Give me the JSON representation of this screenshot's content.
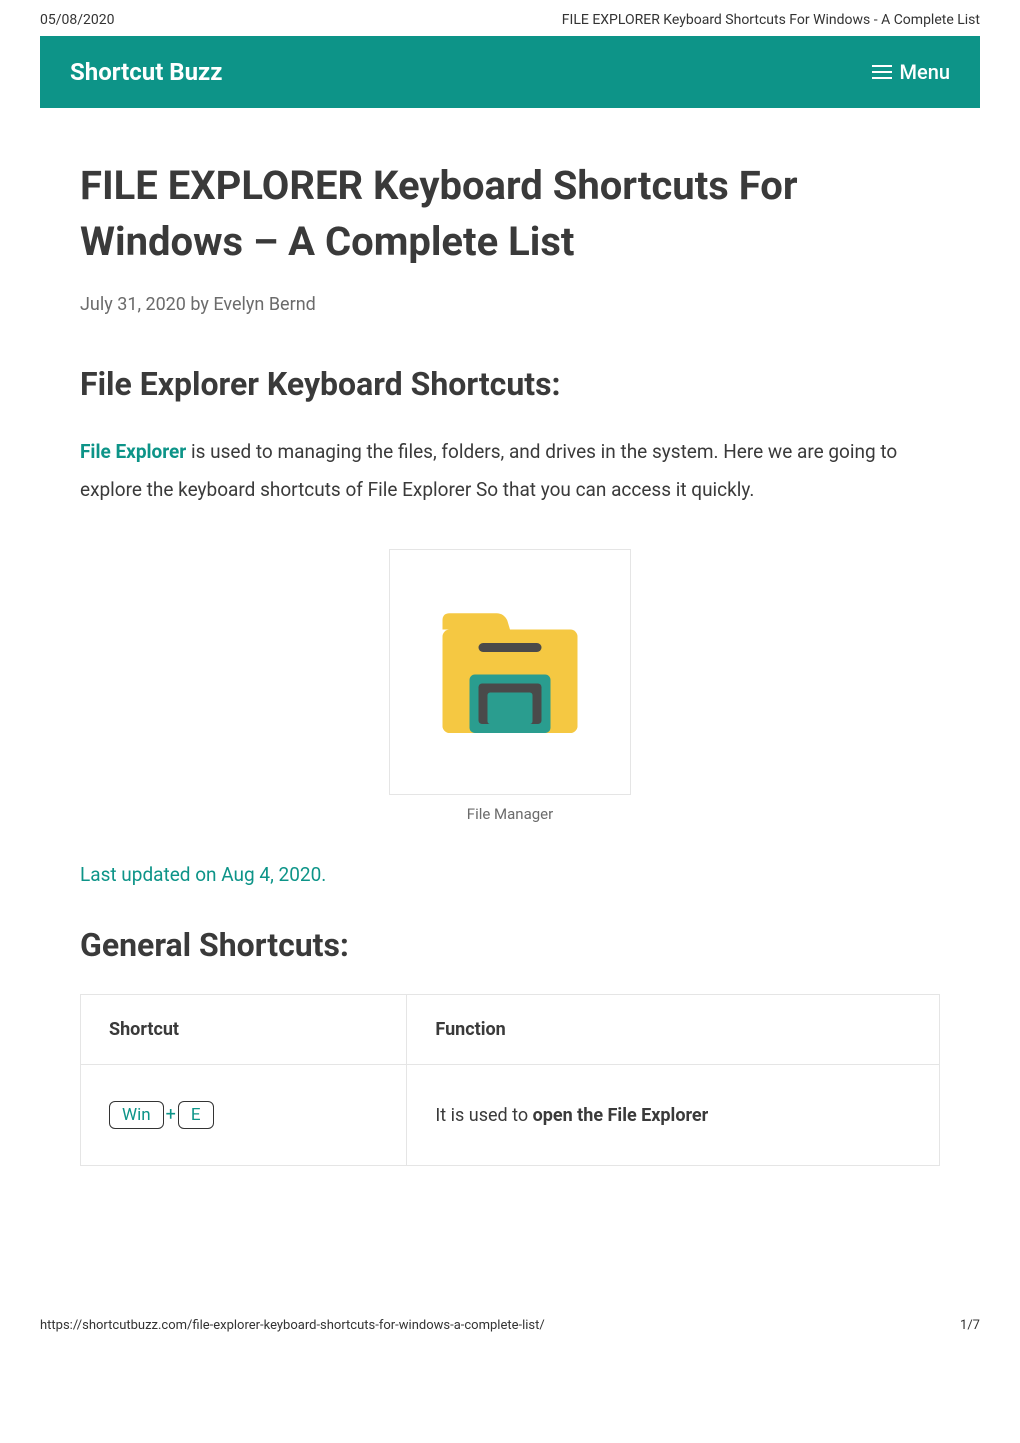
{
  "header": {
    "date": "05/08/2020",
    "page_title": "FILE EXPLORER Keyboard Shortcuts For Windows - A Complete List"
  },
  "nav": {
    "site_name": "Shortcut Buzz",
    "menu_label": "Menu"
  },
  "article": {
    "title": "FILE EXPLORER Keyboard Shortcuts For Windows – A Complete List",
    "date": "July 31, 2020",
    "author_prefix": "by",
    "author": "Evelyn Bernd",
    "section1_heading": "File Explorer Keyboard Shortcuts:",
    "file_explorer_link_text": "File Explorer",
    "intro_text": " is used to managing the files, folders, and drives in the system. Here we are going to explore the keyboard shortcuts of File Explorer So that you can access it quickly.",
    "figure_caption": "File Manager",
    "last_updated": "Last updated on Aug 4, 2020.",
    "section2_heading": "General Shortcuts:",
    "table": {
      "headers": {
        "shortcut": "Shortcut",
        "function": "Function"
      },
      "rows": [
        {
          "keys": [
            "Win",
            "E"
          ],
          "function_prefix": "It is used to ",
          "function_bold": "open the File Explorer"
        }
      ]
    }
  },
  "footer": {
    "url": "https://shortcutbuzz.com/file-explorer-keyboard-shortcuts-for-windows-a-complete-list/",
    "page_number": "1/7"
  }
}
